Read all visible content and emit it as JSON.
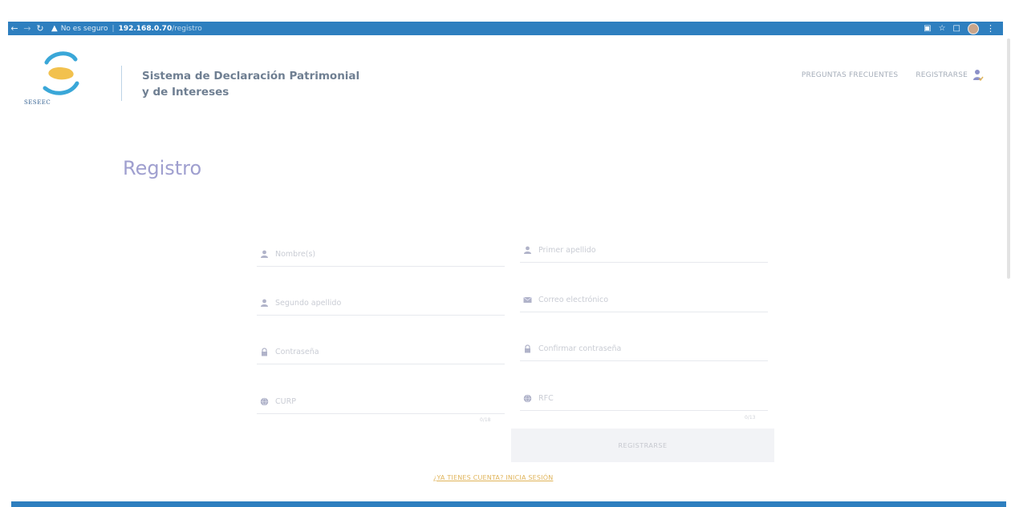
{
  "browser": {
    "security_label": "No es seguro",
    "url_host": "192.168.0.70",
    "url_path": "/registro",
    "icons": [
      "back-icon",
      "forward-icon",
      "reload-icon",
      "warning-icon",
      "translate-icon",
      "star-icon",
      "extension-icon",
      "profile-avatar",
      "menu-kebab-icon"
    ]
  },
  "header": {
    "logo_text": "SESEEC",
    "title_line1": "Sistema de Declaración Patrimonial",
    "title_line2": "y de Intereses",
    "nav": {
      "faq": "PREGUNTAS FRECUENTES",
      "register": "REGISTRARSE"
    }
  },
  "page": {
    "title": "Registro"
  },
  "form": {
    "nombre": {
      "placeholder": "Nombre(s)",
      "icon": "user-icon"
    },
    "primer_apellido": {
      "placeholder": "Primer apellido",
      "icon": "user-icon"
    },
    "segundo_apellido": {
      "placeholder": "Segundo apellido",
      "icon": "user-icon"
    },
    "correo": {
      "placeholder": "Correo electrónico",
      "icon": "envelope-icon"
    },
    "contrasena": {
      "placeholder": "Contraseña",
      "icon": "lock-icon"
    },
    "confirmar": {
      "placeholder": "Confirmar contraseña",
      "icon": "lock-icon"
    },
    "curp": {
      "placeholder": "CURP",
      "icon": "globe-icon",
      "counter": "0/18"
    },
    "rfc": {
      "placeholder": "RFC",
      "icon": "globe-icon",
      "counter": "0/13"
    },
    "submit_label": "REGISTRARSE",
    "login_link": "¿YA TIENES CUENTA? INICIA SESIÓN"
  },
  "colors": {
    "chrome": "#2e7fbf",
    "title": "#9f9fcf",
    "link": "#e0b45a"
  }
}
